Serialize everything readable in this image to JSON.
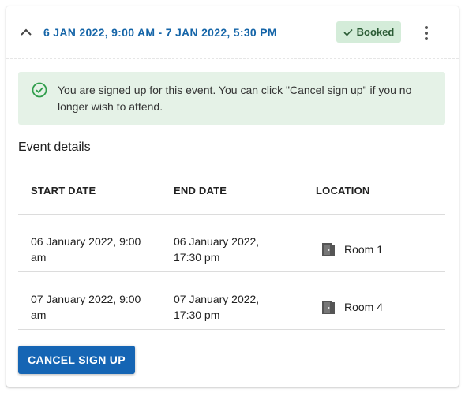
{
  "header": {
    "date_range": "6 JAN 2022, 9:00 AM - 7 JAN 2022, 5:30 PM",
    "status_badge": "Booked",
    "collapse_icon": "chevron-up-icon",
    "menu_icon": "more-vertical-icon"
  },
  "alert": {
    "icon": "check-circle-icon",
    "text": "You are signed up for this event. You can click \"Cancel sign up\" if you no longer wish to attend."
  },
  "details": {
    "title": "Event details",
    "columns": [
      "START DATE",
      "END DATE",
      "LOCATION"
    ],
    "rows": [
      {
        "start_line1": "06 January 2022, 9:00",
        "start_line2": "am",
        "end_line1": "06 January 2022,",
        "end_line2": "17:30 pm",
        "location": "Room 1"
      },
      {
        "start_line1": "07 January 2022, 9:00",
        "start_line2": "am",
        "end_line1": "07 January 2022,",
        "end_line2": "17:30 pm",
        "location": "Room 4"
      }
    ],
    "location_icon": "door-icon"
  },
  "actions": {
    "cancel_label": "CANCEL SIGN UP"
  },
  "colors": {
    "accent": "#1565a8",
    "button": "#1565b4",
    "badge_bg": "#d4ecd9",
    "alert_bg": "#e5f2e7",
    "success": "#2e9d4a"
  }
}
